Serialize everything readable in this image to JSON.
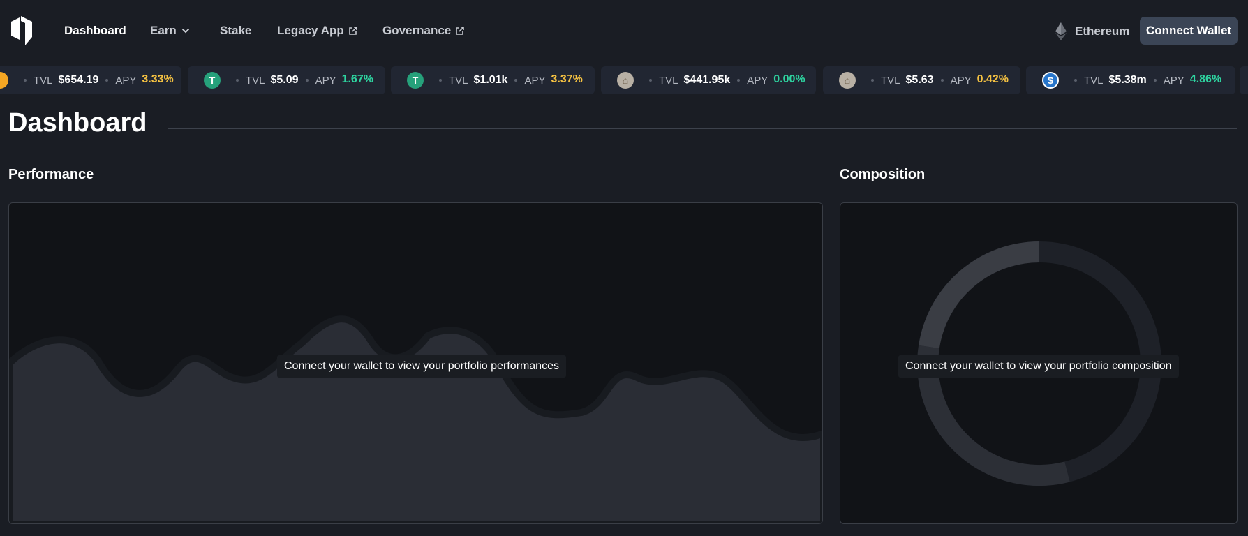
{
  "nav": {
    "links": [
      {
        "label": "Dashboard"
      },
      {
        "label": "Earn"
      },
      {
        "label": "Stake"
      },
      {
        "label": "Legacy App"
      },
      {
        "label": "Governance"
      }
    ],
    "network": "Ethereum",
    "connect_label": "Connect Wallet"
  },
  "ticker": [
    {
      "token_icon": "orange-token-icon",
      "tvl_label": "TVL",
      "tvl": "$654.19",
      "apy_label": "APY",
      "apy": "3.33%",
      "apy_color": "#f5c242"
    },
    {
      "token_icon": "usdt-icon",
      "tvl_label": "TVL",
      "tvl": "$5.09",
      "apy_label": "APY",
      "apy": "1.67%",
      "apy_color": "#2ed4a0"
    },
    {
      "token_icon": "usdt-icon",
      "tvl_label": "TVL",
      "tvl": "$1.01k",
      "apy_label": "APY",
      "apy": "3.37%",
      "apy_color": "#f5c242"
    },
    {
      "token_icon": "house-token-icon",
      "tvl_label": "TVL",
      "tvl": "$441.95k",
      "apy_label": "APY",
      "apy": "0.00%",
      "apy_color": "#2ed4a0"
    },
    {
      "token_icon": "house-token-icon",
      "tvl_label": "TVL",
      "tvl": "$5.63",
      "apy_label": "APY",
      "apy": "0.42%",
      "apy_color": "#f5c242"
    },
    {
      "token_icon": "usdc-icon",
      "tvl_label": "TVL",
      "tvl": "$5.38m",
      "apy_label": "APY",
      "apy": "4.86%",
      "apy_color": "#2ed4a0"
    }
  ],
  "page": {
    "title": "Dashboard"
  },
  "performance": {
    "title": "Performance",
    "message": "Connect your wallet to view your portfolio performances"
  },
  "composition": {
    "title": "Composition",
    "message": "Connect your wallet to view your portfolio composition"
  },
  "colors": {
    "background": "#1a1d24",
    "panel": "#111317",
    "button": "#3b4556",
    "apy_yellow": "#f5c242",
    "apy_green": "#2ed4a0"
  }
}
